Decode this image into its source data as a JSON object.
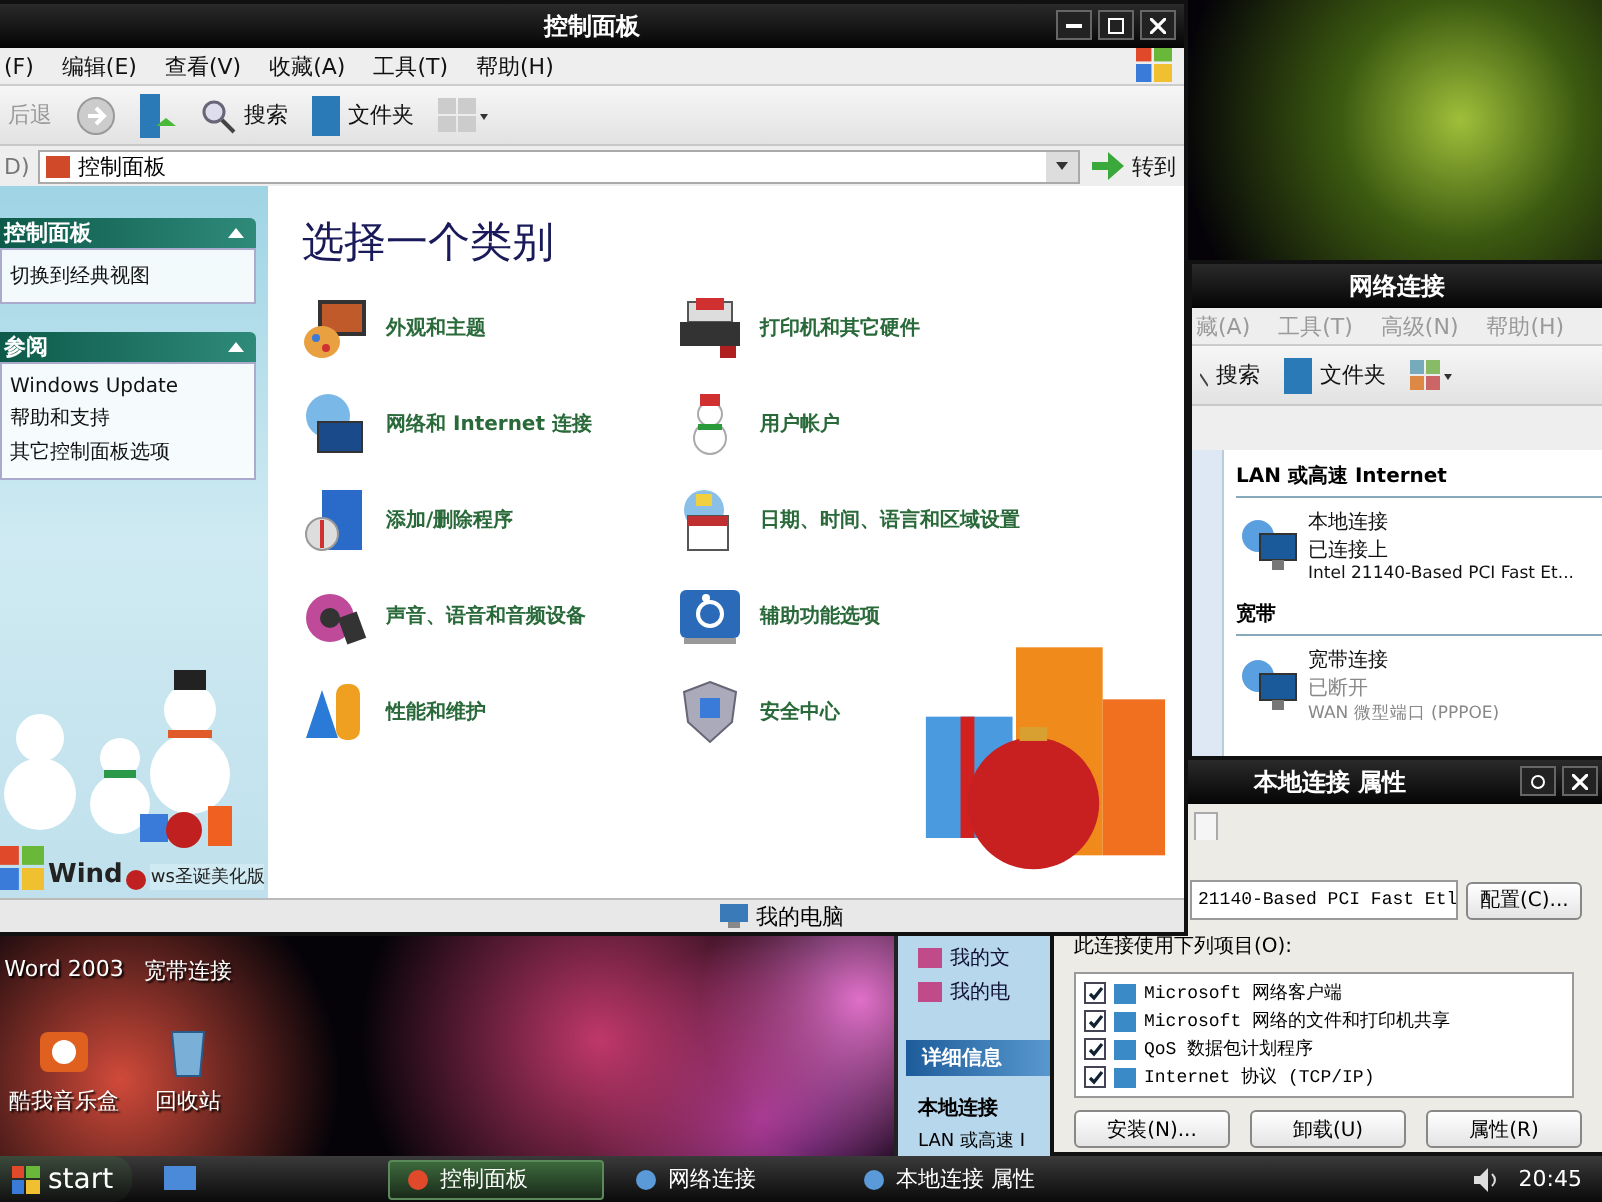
{
  "desktop_icons": [
    {
      "label": "Word 2003",
      "kind": "covered"
    },
    {
      "label": "宽带连接",
      "kind": "covered"
    },
    {
      "label": "酷我音乐盒",
      "kind": "music"
    },
    {
      "label": "回收站",
      "kind": "recycle"
    }
  ],
  "task_pane": {
    "items": [
      "我的文",
      "我的电"
    ],
    "details_title": "详细信息",
    "details": [
      "本地连接",
      "LAN 或高速 I"
    ]
  },
  "network_window": {
    "title": "网络连接",
    "menu": [
      "藏(A)",
      "工具(T)",
      "高级(N)",
      "帮助(H)"
    ],
    "toolbar": {
      "search": "搜索",
      "folders": "文件夹"
    },
    "groups": [
      {
        "title": "LAN 或高速 Internet",
        "items": [
          {
            "name": "本地连接",
            "status": "已连接上",
            "device": "Intel 21140-Based PCI Fast Et...",
            "connected": true
          }
        ]
      },
      {
        "title": "宽带",
        "items": [
          {
            "name": "宽带连接",
            "status": "已断开",
            "device": "WAN 微型端口 (PPPOE)",
            "connected": false
          }
        ]
      }
    ]
  },
  "properties_dialog": {
    "title": "本地连接 属性",
    "device": "21140-Based PCI Fast Etl",
    "configure": "配置(C)...",
    "list_label": "此连接使用下列项目(O):",
    "components": [
      {
        "label": "Microsoft 网络客户端",
        "checked": true
      },
      {
        "label": "Microsoft 网络的文件和打印机共享",
        "checked": true
      },
      {
        "label": "QoS 数据包计划程序",
        "checked": true
      },
      {
        "label": "Internet 协议 (TCP/IP)",
        "checked": true
      }
    ],
    "buttons": [
      "安装(N)...",
      "卸载(U)",
      "属性(R)"
    ]
  },
  "control_panel": {
    "title": "控制面板",
    "menu": [
      "(F)",
      "编辑(E)",
      "查看(V)",
      "收藏(A)",
      "工具(T)",
      "帮助(H)"
    ],
    "toolbar": {
      "back": "后退",
      "search": "搜索",
      "folders": "文件夹"
    },
    "address": {
      "label": "D)",
      "value": "控制面板",
      "go": "转到"
    },
    "side_panels": [
      {
        "title": "控制面板",
        "expanded": true,
        "items": [
          "切换到经典视图"
        ]
      },
      {
        "title": "参阅",
        "expanded": true,
        "items": [
          "Windows Update",
          "帮助和支持",
          "其它控制面板选项"
        ]
      }
    ],
    "brand": [
      "Wind",
      "ws圣诞美化版"
    ],
    "heading": "选择一个类别",
    "categories": [
      {
        "label": "外观和主题",
        "kind": "appearance"
      },
      {
        "label": "打印机和其它硬件",
        "kind": "printer"
      },
      {
        "label": "网络和 Internet 连接",
        "kind": "network"
      },
      {
        "label": "用户帐户",
        "kind": "user"
      },
      {
        "label": "添加/删除程序",
        "kind": "programs"
      },
      {
        "label": "日期、时间、语言和区域设置",
        "kind": "datetime"
      },
      {
        "label": "声音、语音和音频设备",
        "kind": "sound"
      },
      {
        "label": "辅助功能选项",
        "kind": "accessibility"
      },
      {
        "label": "性能和维护",
        "kind": "performance"
      },
      {
        "label": "安全中心",
        "kind": "security"
      }
    ],
    "status": "我的电脑"
  },
  "taskbar": {
    "start": "start",
    "tasks": [
      {
        "label": "控制面板",
        "selected": true
      },
      {
        "label": "网络连接",
        "selected": false
      },
      {
        "label": "本地连接 属性",
        "selected": false
      }
    ],
    "clock": "20:45"
  }
}
